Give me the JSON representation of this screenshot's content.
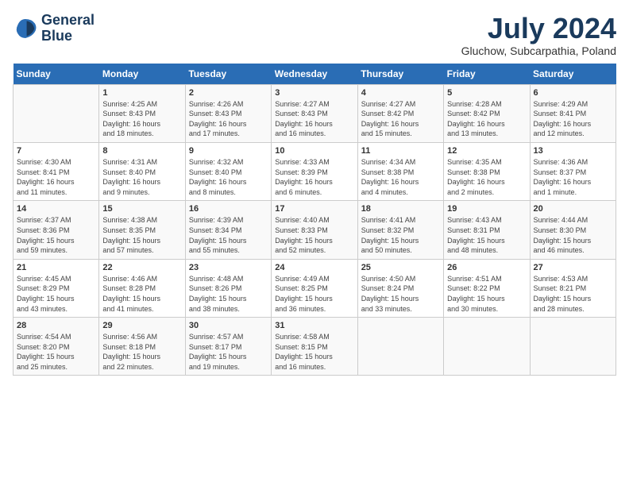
{
  "header": {
    "logo_line1": "General",
    "logo_line2": "Blue",
    "month_year": "July 2024",
    "location": "Gluchow, Subcarpathia, Poland"
  },
  "weekdays": [
    "Sunday",
    "Monday",
    "Tuesday",
    "Wednesday",
    "Thursday",
    "Friday",
    "Saturday"
  ],
  "weeks": [
    [
      {
        "day": "",
        "info": ""
      },
      {
        "day": "1",
        "info": "Sunrise: 4:25 AM\nSunset: 8:43 PM\nDaylight: 16 hours\nand 18 minutes."
      },
      {
        "day": "2",
        "info": "Sunrise: 4:26 AM\nSunset: 8:43 PM\nDaylight: 16 hours\nand 17 minutes."
      },
      {
        "day": "3",
        "info": "Sunrise: 4:27 AM\nSunset: 8:43 PM\nDaylight: 16 hours\nand 16 minutes."
      },
      {
        "day": "4",
        "info": "Sunrise: 4:27 AM\nSunset: 8:42 PM\nDaylight: 16 hours\nand 15 minutes."
      },
      {
        "day": "5",
        "info": "Sunrise: 4:28 AM\nSunset: 8:42 PM\nDaylight: 16 hours\nand 13 minutes."
      },
      {
        "day": "6",
        "info": "Sunrise: 4:29 AM\nSunset: 8:41 PM\nDaylight: 16 hours\nand 12 minutes."
      }
    ],
    [
      {
        "day": "7",
        "info": "Sunrise: 4:30 AM\nSunset: 8:41 PM\nDaylight: 16 hours\nand 11 minutes."
      },
      {
        "day": "8",
        "info": "Sunrise: 4:31 AM\nSunset: 8:40 PM\nDaylight: 16 hours\nand 9 minutes."
      },
      {
        "day": "9",
        "info": "Sunrise: 4:32 AM\nSunset: 8:40 PM\nDaylight: 16 hours\nand 8 minutes."
      },
      {
        "day": "10",
        "info": "Sunrise: 4:33 AM\nSunset: 8:39 PM\nDaylight: 16 hours\nand 6 minutes."
      },
      {
        "day": "11",
        "info": "Sunrise: 4:34 AM\nSunset: 8:38 PM\nDaylight: 16 hours\nand 4 minutes."
      },
      {
        "day": "12",
        "info": "Sunrise: 4:35 AM\nSunset: 8:38 PM\nDaylight: 16 hours\nand 2 minutes."
      },
      {
        "day": "13",
        "info": "Sunrise: 4:36 AM\nSunset: 8:37 PM\nDaylight: 16 hours\nand 1 minute."
      }
    ],
    [
      {
        "day": "14",
        "info": "Sunrise: 4:37 AM\nSunset: 8:36 PM\nDaylight: 15 hours\nand 59 minutes."
      },
      {
        "day": "15",
        "info": "Sunrise: 4:38 AM\nSunset: 8:35 PM\nDaylight: 15 hours\nand 57 minutes."
      },
      {
        "day": "16",
        "info": "Sunrise: 4:39 AM\nSunset: 8:34 PM\nDaylight: 15 hours\nand 55 minutes."
      },
      {
        "day": "17",
        "info": "Sunrise: 4:40 AM\nSunset: 8:33 PM\nDaylight: 15 hours\nand 52 minutes."
      },
      {
        "day": "18",
        "info": "Sunrise: 4:41 AM\nSunset: 8:32 PM\nDaylight: 15 hours\nand 50 minutes."
      },
      {
        "day": "19",
        "info": "Sunrise: 4:43 AM\nSunset: 8:31 PM\nDaylight: 15 hours\nand 48 minutes."
      },
      {
        "day": "20",
        "info": "Sunrise: 4:44 AM\nSunset: 8:30 PM\nDaylight: 15 hours\nand 46 minutes."
      }
    ],
    [
      {
        "day": "21",
        "info": "Sunrise: 4:45 AM\nSunset: 8:29 PM\nDaylight: 15 hours\nand 43 minutes."
      },
      {
        "day": "22",
        "info": "Sunrise: 4:46 AM\nSunset: 8:28 PM\nDaylight: 15 hours\nand 41 minutes."
      },
      {
        "day": "23",
        "info": "Sunrise: 4:48 AM\nSunset: 8:26 PM\nDaylight: 15 hours\nand 38 minutes."
      },
      {
        "day": "24",
        "info": "Sunrise: 4:49 AM\nSunset: 8:25 PM\nDaylight: 15 hours\nand 36 minutes."
      },
      {
        "day": "25",
        "info": "Sunrise: 4:50 AM\nSunset: 8:24 PM\nDaylight: 15 hours\nand 33 minutes."
      },
      {
        "day": "26",
        "info": "Sunrise: 4:51 AM\nSunset: 8:22 PM\nDaylight: 15 hours\nand 30 minutes."
      },
      {
        "day": "27",
        "info": "Sunrise: 4:53 AM\nSunset: 8:21 PM\nDaylight: 15 hours\nand 28 minutes."
      }
    ],
    [
      {
        "day": "28",
        "info": "Sunrise: 4:54 AM\nSunset: 8:20 PM\nDaylight: 15 hours\nand 25 minutes."
      },
      {
        "day": "29",
        "info": "Sunrise: 4:56 AM\nSunset: 8:18 PM\nDaylight: 15 hours\nand 22 minutes."
      },
      {
        "day": "30",
        "info": "Sunrise: 4:57 AM\nSunset: 8:17 PM\nDaylight: 15 hours\nand 19 minutes."
      },
      {
        "day": "31",
        "info": "Sunrise: 4:58 AM\nSunset: 8:15 PM\nDaylight: 15 hours\nand 16 minutes."
      },
      {
        "day": "",
        "info": ""
      },
      {
        "day": "",
        "info": ""
      },
      {
        "day": "",
        "info": ""
      }
    ]
  ]
}
